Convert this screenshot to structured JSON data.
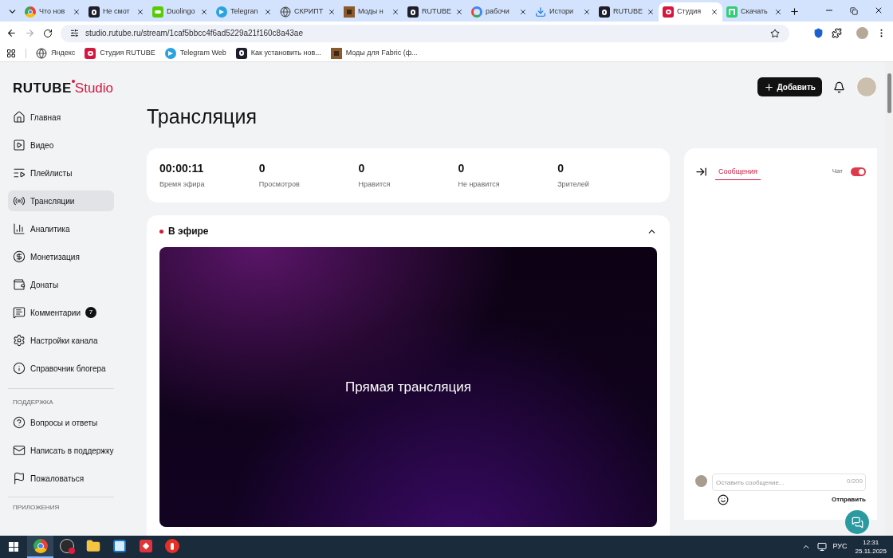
{
  "browser": {
    "tabs": [
      {
        "title": "Что нов",
        "kind": "chrome",
        "selected": false
      },
      {
        "title": "Не смот",
        "kind": "rutube",
        "selected": false
      },
      {
        "title": "Duolingo",
        "kind": "duo",
        "selected": false
      },
      {
        "title": "Telegran",
        "kind": "telegram",
        "selected": false
      },
      {
        "title": "СКРИПТ",
        "kind": "globe",
        "selected": false
      },
      {
        "title": "Моды н",
        "kind": "mc",
        "selected": false
      },
      {
        "title": "RUTUBE",
        "kind": "rutube",
        "selected": false
      },
      {
        "title": "рабочи",
        "kind": "google",
        "selected": false
      },
      {
        "title": "Истори",
        "kind": "download",
        "selected": false
      },
      {
        "title": "RUTUBE",
        "kind": "rutube",
        "selected": false
      },
      {
        "title": "Студия",
        "kind": "studio",
        "selected": true
      },
      {
        "title": "Скачать",
        "kind": "green",
        "selected": false
      }
    ],
    "url": "studio.rutube.ru/stream/1caf5bbcc4f6ad5229a21f160c8a43ae",
    "bookmarks": [
      {
        "title": "Яндекс",
        "kind": "globe"
      },
      {
        "title": "Студия RUTUBE",
        "kind": "studio"
      },
      {
        "title": "Telegram Web",
        "kind": "telegram"
      },
      {
        "title": "Как установить нов...",
        "kind": "rutube"
      },
      {
        "title": "Моды для Fabric (ф...",
        "kind": "mc"
      }
    ]
  },
  "header": {
    "logo_main": "RUTUBE",
    "logo_sub": "Studio",
    "add_button": "Добавить"
  },
  "sidebar": {
    "items": [
      {
        "label": "Главная",
        "kind": "home",
        "selected": false
      },
      {
        "label": "Видео",
        "kind": "video",
        "selected": false
      },
      {
        "label": "Плейлисты",
        "kind": "playlist",
        "selected": false
      },
      {
        "label": "Трансляции",
        "kind": "radio",
        "selected": true
      },
      {
        "label": "Аналитика",
        "kind": "chart",
        "selected": false
      },
      {
        "label": "Монетизация",
        "kind": "ruble",
        "selected": false
      },
      {
        "label": "Донаты",
        "kind": "wallet",
        "selected": false
      },
      {
        "label": "Комментарии",
        "kind": "comment",
        "selected": false,
        "badge": "7"
      },
      {
        "label": "Настройки канала",
        "kind": "gear",
        "selected": false
      },
      {
        "label": "Справочник блогера",
        "kind": "info",
        "selected": false
      }
    ],
    "support_title": "ПОДДЕРЖКА",
    "support_items": [
      {
        "label": "Вопросы и ответы",
        "kind": "help"
      },
      {
        "label": "Написать в поддержку",
        "kind": "mail"
      },
      {
        "label": "Пожаловаться",
        "kind": "flag"
      }
    ],
    "apps_title": "ПРИЛОЖЕНИЯ"
  },
  "page_title": "Трансляция",
  "stats": [
    {
      "value": "00:00:11",
      "label": "Время эфира"
    },
    {
      "value": "0",
      "label": "Просмотров"
    },
    {
      "value": "0",
      "label": "Нравится"
    },
    {
      "value": "0",
      "label": "Не нравится"
    },
    {
      "value": "0",
      "label": "Зрителей"
    }
  ],
  "live": {
    "status": "В эфире",
    "expanded": true,
    "player_text": "Прямая трансляция"
  },
  "chat": {
    "tab": "Сообщения",
    "toggle_label": "Чат",
    "on": true,
    "placeholder": "Оставить сообщение...",
    "counter": "0/200",
    "send": "Отправить"
  },
  "taskbar": {
    "apps": [
      {
        "kind": "chrome",
        "selected": true
      },
      {
        "kind": "obs",
        "selected": false
      },
      {
        "kind": "folder",
        "selected": false
      },
      {
        "kind": "app",
        "selected": false
      },
      {
        "kind": "red",
        "selected": false
      },
      {
        "kind": "yandex",
        "selected": false
      }
    ],
    "lang": "РУС",
    "time": "12:31",
    "date": "25.11.2025"
  }
}
